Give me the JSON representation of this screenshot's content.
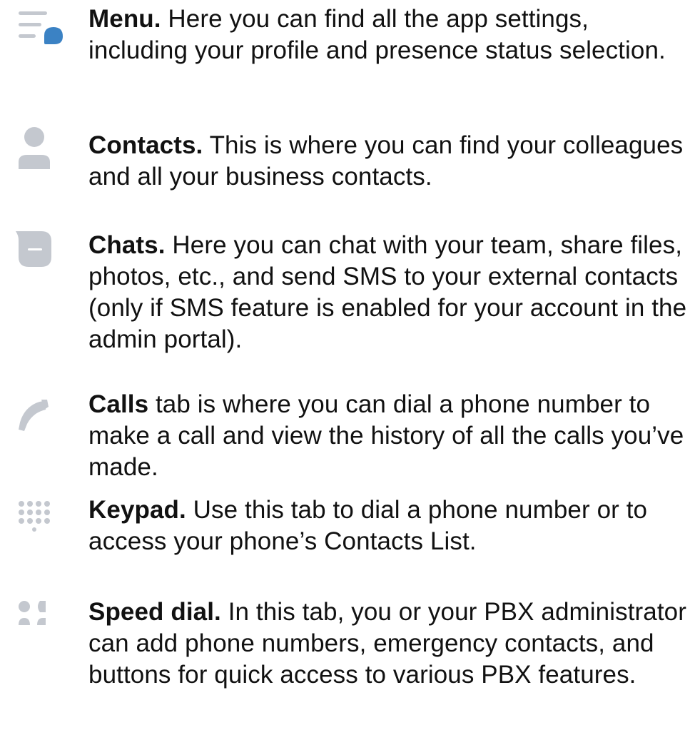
{
  "items": [
    {
      "icon": "menu-icon",
      "title": "Menu.",
      "body": " Here you can find all the app settings, including your profile and presence status selection."
    },
    {
      "icon": "contacts-icon",
      "title": "Contacts.",
      "body": " This is where you can find your colleagues and all your business contacts."
    },
    {
      "icon": "chats-icon",
      "title": "Chats.",
      "body": " Here you can chat with your team, share files, photos, etc., and send SMS to your external contacts (only if SMS feature is enabled for your account in the admin portal)."
    },
    {
      "icon": "calls-icon",
      "title": "Calls",
      "body": " tab is where you can dial a phone number to make a call and view the history of all the calls you’ve made."
    },
    {
      "icon": "keypad-icon",
      "title": "Keypad.",
      "body": " Use this tab to dial a phone number or to access your phone’s Contacts List."
    },
    {
      "icon": "speed-dial-icon",
      "title": "Speed dial.",
      "body": " In this tab, you or your PBX administrator can add phone numbers, emergency contacts, and buttons for quick access to various PBX features."
    }
  ],
  "colors": {
    "icon_grey": "#c4c8cf",
    "accent_blue": "#3b82c4",
    "text": "#111111"
  }
}
